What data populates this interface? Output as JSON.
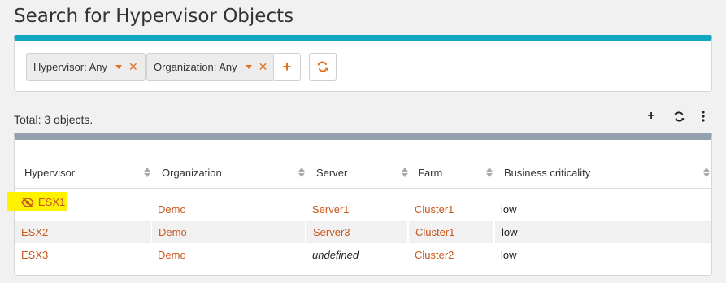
{
  "page": {
    "title": "Search for Hypervisor Objects"
  },
  "filters": {
    "chips": [
      {
        "label": "Hypervisor: Any"
      },
      {
        "label": "Organization: Any"
      }
    ],
    "add_icon": "plus-icon",
    "refresh_icon": "refresh-icon"
  },
  "results": {
    "total_text": "Total: 3 objects.",
    "toolbar_icons": [
      "plus-icon",
      "refresh-icon",
      "kebab-menu-icon"
    ]
  },
  "table": {
    "columns": [
      "Hypervisor",
      "Organization",
      "Server",
      "Farm",
      "Business criticality"
    ],
    "rows": [
      {
        "hypervisor": "ESX1",
        "organization": "Demo",
        "server": "Server1",
        "farm": "Cluster1",
        "criticality": "low",
        "hidden_icon": "eye-slash-icon",
        "highlighted": true
      },
      {
        "hypervisor": "ESX2",
        "organization": "Demo",
        "server": "Server3",
        "farm": "Cluster1",
        "criticality": "low"
      },
      {
        "hypervisor": "ESX3",
        "organization": "Demo",
        "server": "undefined",
        "farm": "Cluster2",
        "criticality": "low"
      }
    ]
  },
  "colors": {
    "accent": "#e07020",
    "link": "#c8561d",
    "filter_bar": "#0fa7c2",
    "table_bar": "#95a1ae",
    "highlight": "#fff200"
  }
}
